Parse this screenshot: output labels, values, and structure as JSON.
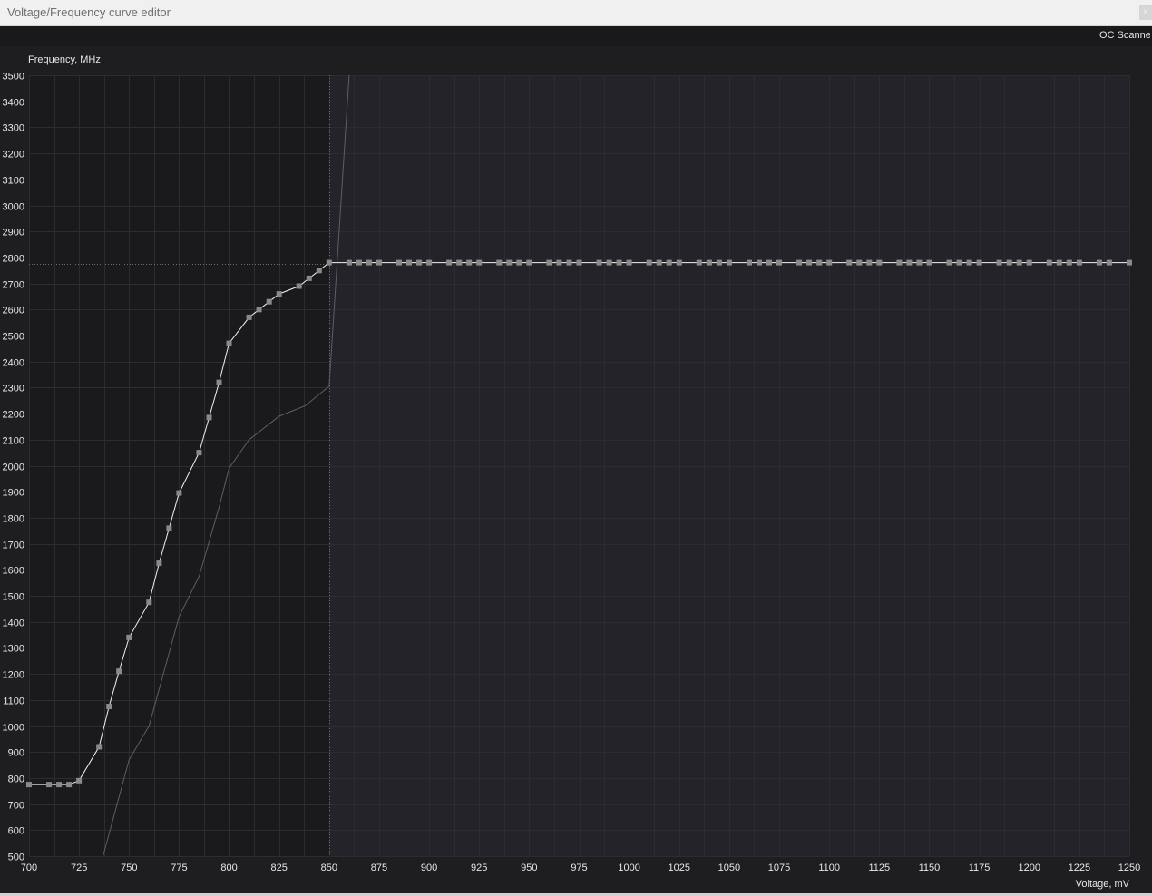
{
  "window": {
    "title": "Voltage/Frequency curve editor",
    "close_glyph": "×",
    "close_icon": "close-icon"
  },
  "toolbar": {
    "oc_scanner_label": "OC Scanner"
  },
  "colors": {
    "plot_bg": "#232329",
    "locked_region_bg": "#1a1a1c",
    "grid": "#2c2c33",
    "curve": "#f2f2f2",
    "point": "#8a8a8a",
    "default_curve": "#5e5e64",
    "cursor_line": "#6c6c72"
  },
  "chart_data": {
    "type": "line",
    "title": "",
    "xlabel": "Voltage, mV",
    "ylabel": "Frequency, MHz",
    "xlim": [
      700,
      1250
    ],
    "ylim": [
      500,
      3500
    ],
    "xticks": [
      700,
      725,
      750,
      775,
      800,
      825,
      850,
      875,
      900,
      925,
      950,
      975,
      1000,
      1025,
      1050,
      1075,
      1100,
      1125,
      1150,
      1175,
      1200,
      1225,
      1250
    ],
    "yticks": [
      500,
      600,
      700,
      800,
      900,
      1000,
      1100,
      1200,
      1300,
      1400,
      1500,
      1600,
      1700,
      1800,
      1900,
      2000,
      2100,
      2200,
      2300,
      2400,
      2500,
      2600,
      2700,
      2800,
      2900,
      3000,
      3100,
      3200,
      3300,
      3400,
      3500
    ],
    "x_minor_step": 12.5,
    "locked_voltage": 850,
    "locked_frequency": 2775,
    "grid": true,
    "series": [
      {
        "role": "vf_curve",
        "points": [
          [
            700,
            775
          ],
          [
            710,
            775
          ],
          [
            715,
            775
          ],
          [
            720,
            775
          ],
          [
            725,
            790
          ],
          [
            735,
            920
          ],
          [
            740,
            1075
          ],
          [
            745,
            1210
          ],
          [
            750,
            1340
          ],
          [
            760,
            1475
          ],
          [
            765,
            1625
          ],
          [
            770,
            1760
          ],
          [
            775,
            1895
          ],
          [
            785,
            2050
          ],
          [
            790,
            2185
          ],
          [
            795,
            2320
          ],
          [
            800,
            2470
          ],
          [
            810,
            2570
          ],
          [
            815,
            2600
          ],
          [
            820,
            2630
          ],
          [
            825,
            2660
          ],
          [
            835,
            2690
          ],
          [
            840,
            2720
          ],
          [
            845,
            2750
          ],
          [
            850,
            2780
          ],
          [
            860,
            2780
          ],
          [
            865,
            2780
          ],
          [
            870,
            2780
          ],
          [
            875,
            2780
          ],
          [
            885,
            2780
          ],
          [
            890,
            2780
          ],
          [
            895,
            2780
          ],
          [
            900,
            2780
          ],
          [
            910,
            2780
          ],
          [
            915,
            2780
          ],
          [
            920,
            2780
          ],
          [
            925,
            2780
          ],
          [
            935,
            2780
          ],
          [
            940,
            2780
          ],
          [
            945,
            2780
          ],
          [
            950,
            2780
          ],
          [
            960,
            2780
          ],
          [
            965,
            2780
          ],
          [
            970,
            2780
          ],
          [
            975,
            2780
          ],
          [
            985,
            2780
          ],
          [
            990,
            2780
          ],
          [
            995,
            2780
          ],
          [
            1000,
            2780
          ],
          [
            1010,
            2780
          ],
          [
            1015,
            2780
          ],
          [
            1020,
            2780
          ],
          [
            1025,
            2780
          ],
          [
            1035,
            2780
          ],
          [
            1040,
            2780
          ],
          [
            1045,
            2780
          ],
          [
            1050,
            2780
          ],
          [
            1060,
            2780
          ],
          [
            1065,
            2780
          ],
          [
            1070,
            2780
          ],
          [
            1075,
            2780
          ],
          [
            1085,
            2780
          ],
          [
            1090,
            2780
          ],
          [
            1095,
            2780
          ],
          [
            1100,
            2780
          ],
          [
            1110,
            2780
          ],
          [
            1115,
            2780
          ],
          [
            1120,
            2780
          ],
          [
            1125,
            2780
          ],
          [
            1135,
            2780
          ],
          [
            1140,
            2780
          ],
          [
            1145,
            2780
          ],
          [
            1150,
            2780
          ],
          [
            1160,
            2780
          ],
          [
            1165,
            2780
          ],
          [
            1170,
            2780
          ],
          [
            1175,
            2780
          ],
          [
            1185,
            2780
          ],
          [
            1190,
            2780
          ],
          [
            1195,
            2780
          ],
          [
            1200,
            2780
          ],
          [
            1210,
            2780
          ],
          [
            1215,
            2780
          ],
          [
            1220,
            2780
          ],
          [
            1225,
            2780
          ],
          [
            1235,
            2780
          ],
          [
            1240,
            2780
          ],
          [
            1250,
            2780
          ]
        ]
      },
      {
        "role": "default_curve",
        "points": [
          [
            737,
            500
          ],
          [
            750,
            870
          ],
          [
            760,
            1000
          ],
          [
            775,
            1420
          ],
          [
            785,
            1575
          ],
          [
            795,
            1840
          ],
          [
            800,
            1990
          ],
          [
            810,
            2100
          ],
          [
            825,
            2190
          ],
          [
            838,
            2230
          ],
          [
            850,
            2305
          ],
          [
            851,
            2420
          ],
          [
            860,
            3500
          ]
        ]
      }
    ]
  }
}
